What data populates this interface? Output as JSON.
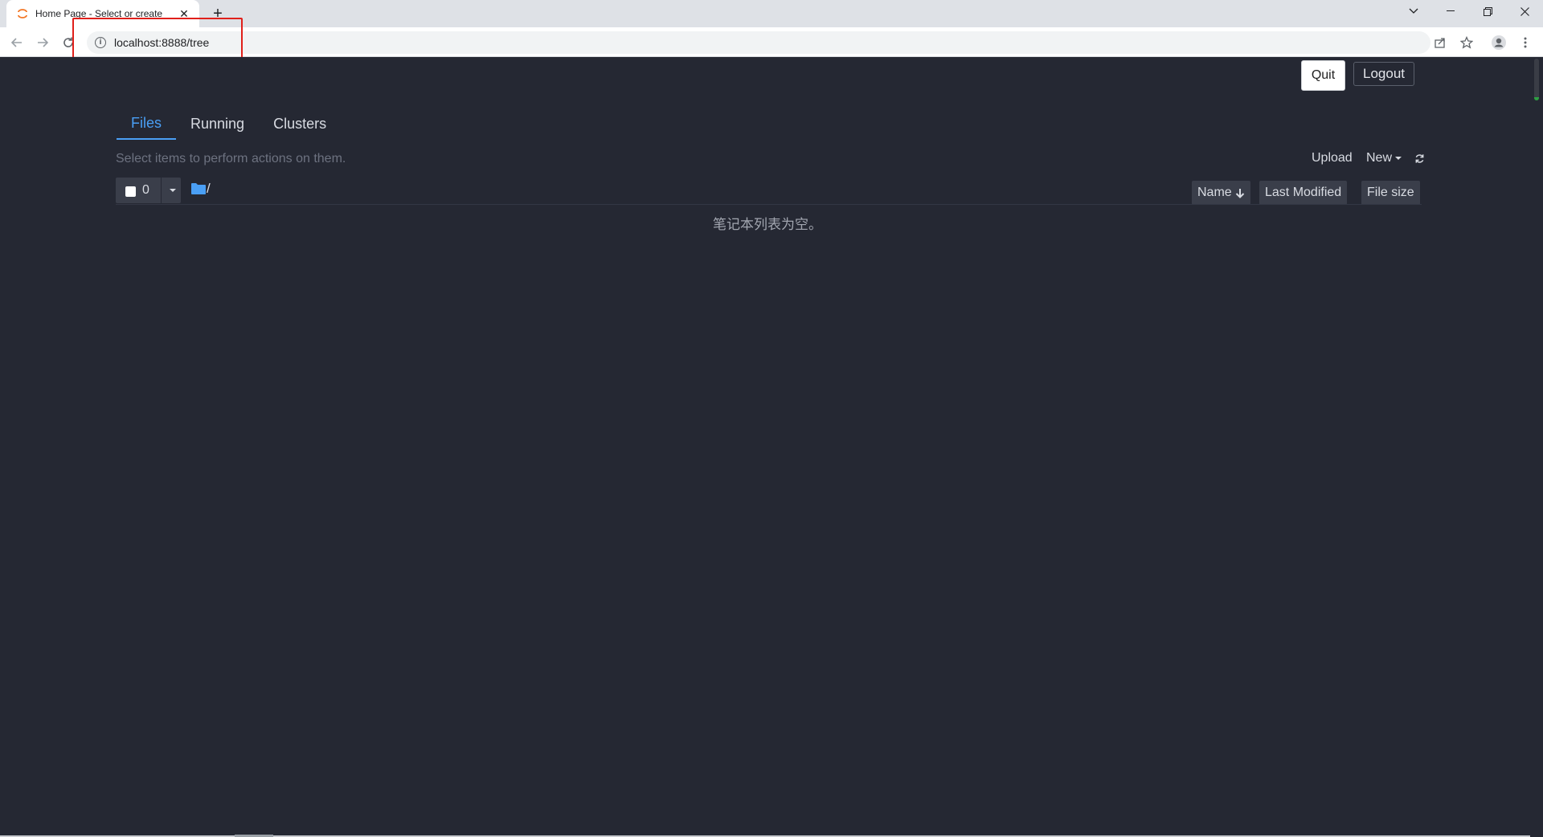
{
  "browser": {
    "tab_title": "Home Page - Select or create",
    "url": "localhost:8888/tree",
    "new_tab_symbol": "+",
    "tab_close_symbol": "✕",
    "accent_highlight": "#e0201b"
  },
  "header": {
    "quit_label": "Quit",
    "logout_label": "Logout"
  },
  "tabs": [
    {
      "label": "Files",
      "active": true
    },
    {
      "label": "Running",
      "active": false
    },
    {
      "label": "Clusters",
      "active": false
    }
  ],
  "files": {
    "hint": "Select items to perform actions on them.",
    "upload_label": "Upload",
    "new_label": "New",
    "selected_count": "0",
    "breadcrumb_path": "/",
    "columns": {
      "name": "Name",
      "last_modified": "Last Modified",
      "file_size": "File size"
    },
    "empty_message": "笔记本列表为空。"
  },
  "colors": {
    "page_background": "#252833",
    "active_tab": "#4a9ff5",
    "button_background": "#3a3e4a"
  },
  "icons": [
    "jupyter-favicon",
    "back-arrow-icon",
    "forward-arrow-icon",
    "reload-icon",
    "info-icon",
    "share-icon",
    "star-icon",
    "profile-icon",
    "kebab-menu-icon",
    "folder-icon",
    "refresh-icon",
    "arrow-down-icon"
  ]
}
